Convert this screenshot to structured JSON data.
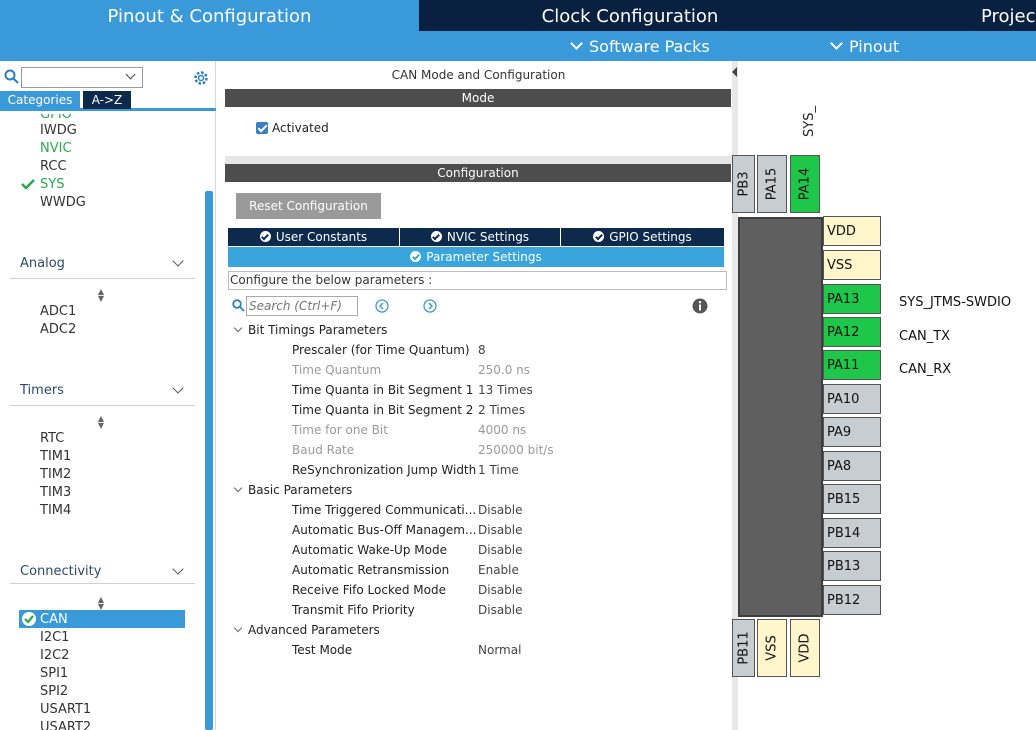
{
  "tabs": {
    "pinout": "Pinout & Configuration",
    "clock": "Clock Configuration",
    "project": "Projec"
  },
  "subbar": {
    "software_packs": "Software Packs",
    "pinout": "Pinout"
  },
  "left": {
    "search": {
      "value": ""
    },
    "cat_tabs": {
      "categories": "Categories",
      "az": "A->Z"
    },
    "system_items": [
      "IWDG",
      "NVIC",
      "RCC",
      "SYS",
      "WWDG"
    ],
    "system_item_colors": [
      "#333333",
      "#2aa84a",
      "#333333",
      "#2aa84a",
      "#333333"
    ],
    "analog": {
      "title": "Analog",
      "items": [
        "ADC1",
        "ADC2"
      ]
    },
    "timers": {
      "title": "Timers",
      "items": [
        "RTC",
        "TIM1",
        "TIM2",
        "TIM3",
        "TIM4"
      ]
    },
    "connectivity": {
      "title": "Connectivity",
      "items": [
        "CAN",
        "I2C1",
        "I2C2",
        "SPI1",
        "SPI2",
        "USART1",
        "USART2"
      ]
    }
  },
  "mid": {
    "title": "CAN Mode and Configuration",
    "mode_bar": "Mode",
    "activated": "Activated",
    "config_bar": "Configuration",
    "reset_button": "Reset Configuration",
    "param_tabs": [
      "User Constants",
      "NVIC Settings",
      "GPIO Settings"
    ],
    "active_tab": "Parameter Settings",
    "configure_text": "Configure the below parameters :",
    "search_placeholder": "Search (Ctrl+F)",
    "sections": {
      "bit_timings": "Bit Timings Parameters",
      "basic": "Basic Parameters",
      "advanced": "Advanced Parameters"
    },
    "bit_timings": [
      {
        "name": "Prescaler (for Time Quantum)",
        "value": "8"
      },
      {
        "name": "Time Quantum",
        "value": "250.0 ns"
      },
      {
        "name": "Time Quanta in Bit Segment 1",
        "value": "13 Times"
      },
      {
        "name": "Time Quanta in Bit Segment 2",
        "value": "2 Times"
      },
      {
        "name": "Time for one Bit",
        "value": "4000 ns"
      },
      {
        "name": "Baud Rate",
        "value": "250000 bit/s"
      },
      {
        "name": "ReSynchronization Jump Width",
        "value": "1 Time"
      }
    ],
    "basic": [
      {
        "name": "Time Triggered Communicati...",
        "value": "Disable"
      },
      {
        "name": "Automatic Bus-Off Managem...",
        "value": "Disable"
      },
      {
        "name": "Automatic Wake-Up Mode",
        "value": "Disable"
      },
      {
        "name": "Automatic Retransmission",
        "value": "Enable"
      },
      {
        "name": "Receive Fifo Locked Mode",
        "value": "Disable"
      },
      {
        "name": "Transmit Fifo Priority",
        "value": "Disable"
      }
    ],
    "advanced": [
      {
        "name": "Test Mode",
        "value": "Normal"
      }
    ]
  },
  "chip": {
    "top_label": "SYS_",
    "top_pins": [
      "PB3",
      "PA15",
      "PA14"
    ],
    "right_pins": [
      "VDD",
      "VSS",
      "PA13",
      "PA12",
      "PA11",
      "PA10",
      "PA9",
      "PA8",
      "PB15",
      "PB14",
      "PB13",
      "PB12"
    ],
    "signals": {
      "PA13": "SYS_JTMS-SWDIO",
      "PA12": "CAN_TX",
      "PA11": "CAN_RX"
    },
    "bottom_pins": [
      "PB11",
      "VSS",
      "VDD"
    ]
  },
  "colors": {
    "accent": "#3a9ad9",
    "dark_nav": "#0a2040",
    "pin_green": "#1ec74a",
    "pin_power": "#fff6cc",
    "pin_gray": "#c8cdd2"
  }
}
